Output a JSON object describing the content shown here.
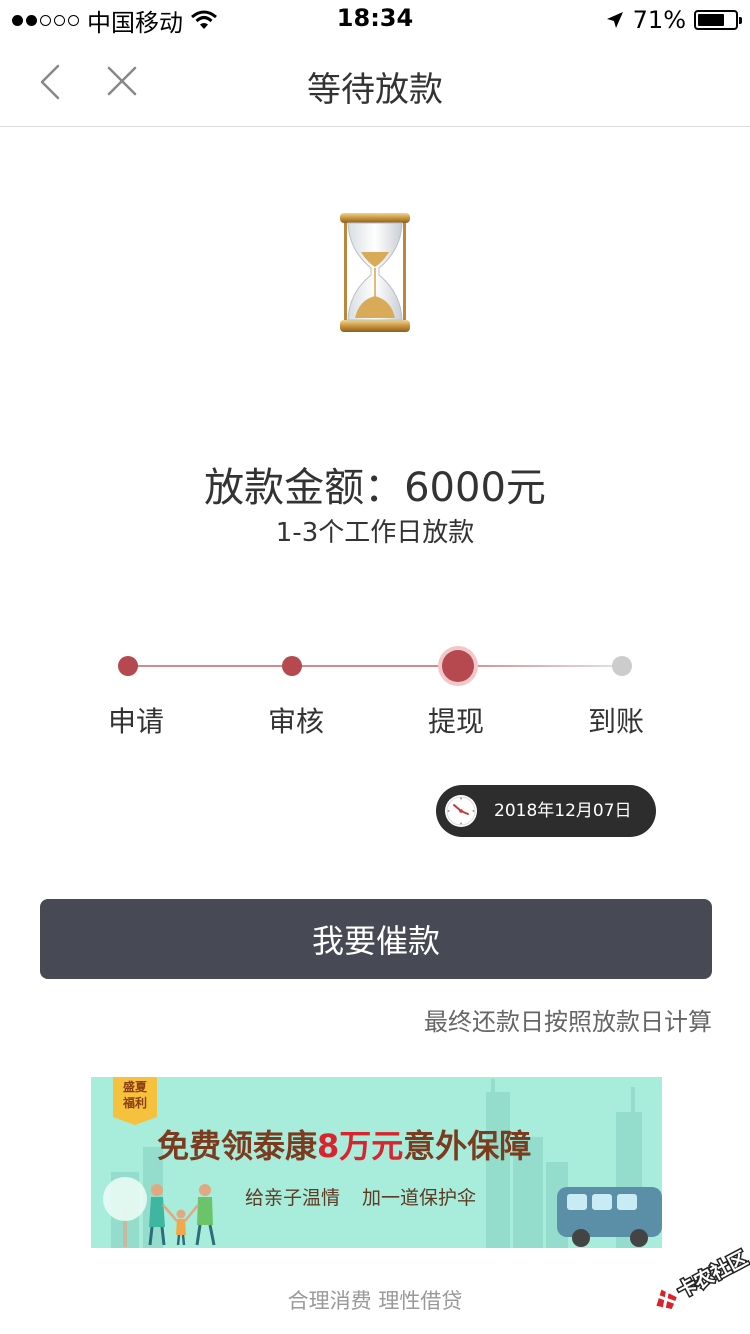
{
  "status_bar": {
    "carrier": "中国移动",
    "time": "18:34",
    "battery_pct": "71%",
    "battery_level": 0.71,
    "signal_bars": 2
  },
  "nav": {
    "title": "等待放款"
  },
  "loan": {
    "amount_text": "放款金额：6000元",
    "timing_text": "1-3个工作日放款"
  },
  "steps": [
    {
      "label": "申请",
      "state": "done"
    },
    {
      "label": "审核",
      "state": "done"
    },
    {
      "label": "提现",
      "state": "current"
    },
    {
      "label": "到账",
      "state": "pending"
    }
  ],
  "date_badge": {
    "text": "2018年12月07日"
  },
  "urge_button": {
    "label": "我要催款"
  },
  "repay_note": "最终还款日按照放款日计算",
  "banner": {
    "badge_line1": "盛夏",
    "badge_line2": "福利",
    "headline_part1": "免费领泰康",
    "headline_highlight": "8万元",
    "headline_part2": "意外保障",
    "sub_part1": "给亲子温情",
    "sub_part2": "加一道保护伞"
  },
  "footer_slogan": "合理消费 理性借贷",
  "colors": {
    "accent_red": "#b6484f",
    "button_dark": "#474a54",
    "pill_dark": "#2d2d2d",
    "banner_bg": "#a8ecdc"
  }
}
